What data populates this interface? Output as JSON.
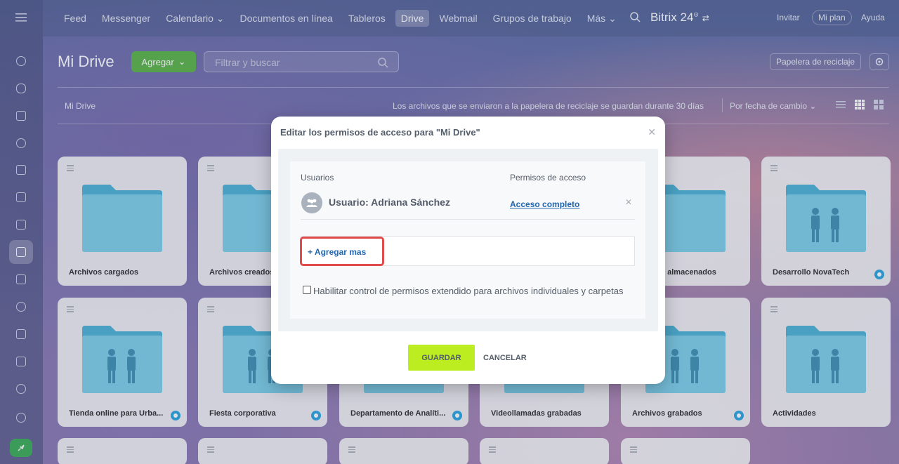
{
  "topnav": {
    "items": [
      "Feed",
      "Messenger",
      "Calendario",
      "Documentos en línea",
      "Tableros",
      "Drive",
      "Webmail",
      "Grupos de trabajo",
      "Más"
    ],
    "brand": "Bitrix 24",
    "invite": "Invitar",
    "plan": "Mi plan",
    "help": "Ayuda"
  },
  "page": {
    "title": "Mi Drive",
    "add_button": "Agregar",
    "filter_placeholder": "Filtrar y buscar",
    "trash_button": "Papelera de reciclaje",
    "breadcrumb": "Mi Drive",
    "trash_note": "Los archivos que se enviaron a la papelera de reciclaje se guardan durante 30 días",
    "sort": "Por fecha de cambio"
  },
  "folders": [
    {
      "name": "Archivos cargados",
      "shared": false
    },
    {
      "name": "Archivos creados",
      "shared": false
    },
    {
      "name": "",
      "shared": false
    },
    {
      "name": "",
      "shared": false
    },
    {
      "name": "Archivos almacenados",
      "shared": false
    },
    {
      "name": "Desarrollo NovaTech",
      "shared": true
    },
    {
      "name": "Tienda online para Urba...",
      "shared": true
    },
    {
      "name": "Fiesta corporativa",
      "shared": true
    },
    {
      "name": "Departamento de Analíti...",
      "shared": true
    },
    {
      "name": "Videollamadas grabadas",
      "shared": false
    },
    {
      "name": "Archivos grabados",
      "shared": true
    },
    {
      "name": "Actividades",
      "shared": false
    }
  ],
  "modal": {
    "title": "Editar los permisos de acceso para \"Mi Drive\"",
    "col_users": "Usuarios",
    "col_access": "Permisos de acceso",
    "user_name": "Usuario: Adriana Sánchez",
    "access_level": "Acceso completo",
    "add_more": "+ Agregar mas",
    "checkbox_label": "Habilitar control de permisos extendido para archivos individuales y carpetas",
    "save": "GUARDAR",
    "cancel": "CANCELAR"
  },
  "colors": {
    "save_bg": "#bbed21",
    "link": "#2067b0",
    "highlight": "#e24b4b",
    "add_bg": "#5fb54c"
  }
}
